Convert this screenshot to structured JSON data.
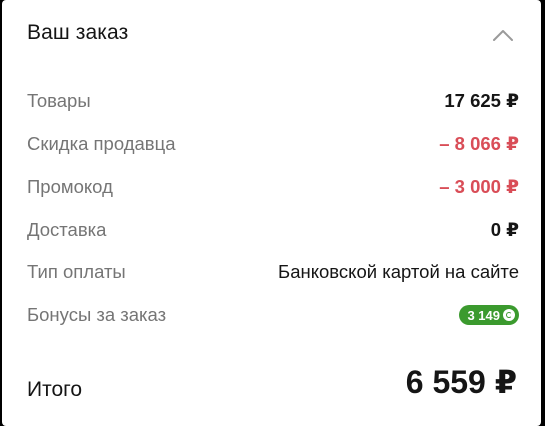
{
  "order": {
    "title": "Ваш заказ",
    "collapse_icon": "chevron-up-icon",
    "rows": {
      "goods": {
        "label": "Товары",
        "value": "17 625 ₽"
      },
      "seller_discount": {
        "label": "Скидка продавца",
        "value": "– 8 066 ₽"
      },
      "promo": {
        "label": "Промокод",
        "value": "– 3 000 ₽"
      },
      "delivery": {
        "label": "Доставка",
        "value": "0 ₽"
      },
      "payment": {
        "label": "Тип оплаты",
        "value": "Банковской картой на сайте"
      },
      "bonus": {
        "label": "Бонусы за заказ",
        "value": "3 149"
      }
    },
    "total": {
      "label": "Итого",
      "value": "6 559 ₽"
    }
  },
  "colors": {
    "discount": "#d94d57",
    "bonus_badge": "#3b9a2e",
    "label_gray": "#757575",
    "text_dark": "#151515"
  }
}
